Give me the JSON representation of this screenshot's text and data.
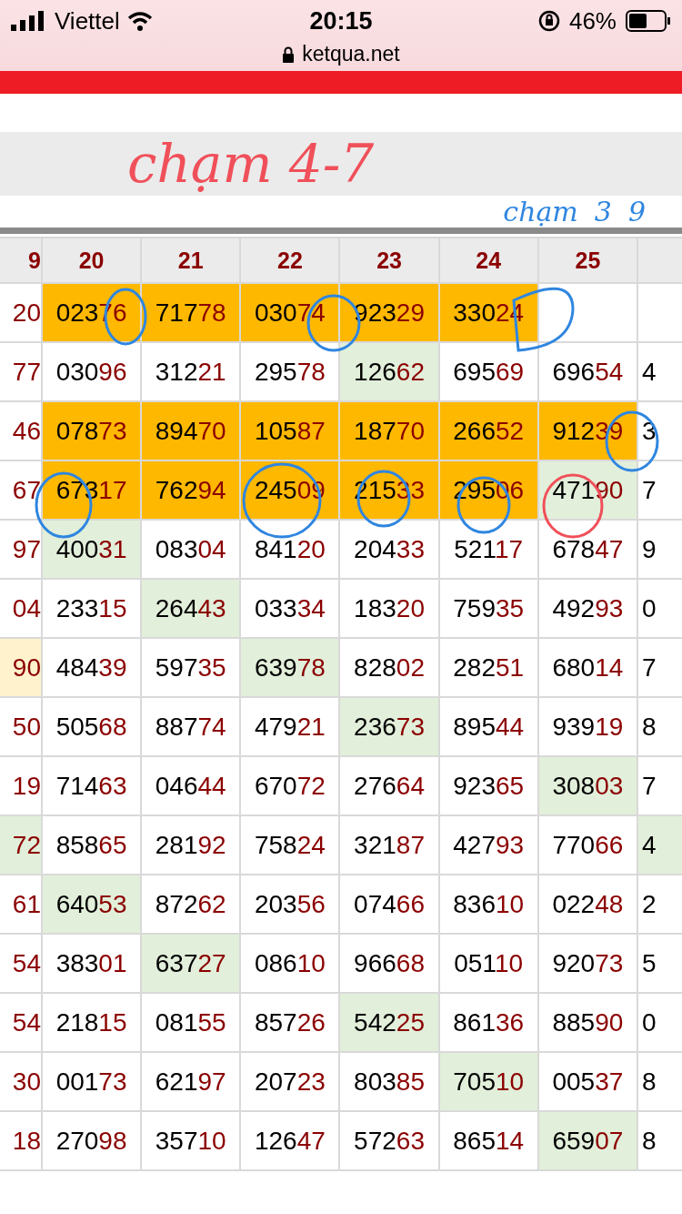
{
  "status_bar": {
    "carrier": "Viettel",
    "time": "20:15",
    "battery": "46%",
    "url": "ketqua.net"
  },
  "annotation": {
    "text": "chạm 4-7",
    "color": "#f0505a"
  },
  "notes": [
    {
      "text": "chạm",
      "color": "#2f86e0"
    },
    {
      "text": "3",
      "color": "#2f86e0"
    },
    {
      "text": "9",
      "color": "#2f86e0"
    }
  ],
  "table": {
    "columns": [
      "9",
      "20",
      "21",
      "22",
      "23",
      "24",
      "25",
      ""
    ],
    "rows": [
      [
        {
          "tail": "20"
        },
        {
          "head": "023",
          "tail": "76",
          "color": "#ffb800"
        },
        {
          "head": "717",
          "tail": "78",
          "color": "#ffb800"
        },
        {
          "head": "030",
          "tail": "74",
          "color": "#ffb800"
        },
        {
          "head": "923",
          "tail": "29",
          "color": "#ffb800"
        },
        {
          "head": "330",
          "tail": "24",
          "color": "#ffb800"
        },
        {},
        {}
      ],
      [
        {
          "tail": "77"
        },
        {
          "head": "030",
          "tail": "96"
        },
        {
          "head": "312",
          "tail": "21"
        },
        {
          "head": "295",
          "tail": "78"
        },
        {
          "head": "126",
          "tail": "62",
          "color": "#e2efda"
        },
        {
          "head": "695",
          "tail": "69"
        },
        {
          "head": "696",
          "tail": "54"
        },
        {
          "head": "4"
        }
      ],
      [
        {
          "tail": "46"
        },
        {
          "head": "078",
          "tail": "73",
          "color": "#ffb800"
        },
        {
          "head": "894",
          "tail": "70",
          "color": "#ffb800"
        },
        {
          "head": "105",
          "tail": "87",
          "color": "#ffb800"
        },
        {
          "head": "187",
          "tail": "70",
          "color": "#ffb800"
        },
        {
          "head": "266",
          "tail": "52",
          "color": "#ffb800"
        },
        {
          "head": "912",
          "tail": "39",
          "color": "#ffb800"
        },
        {
          "head": "3"
        }
      ],
      [
        {
          "tail": "67"
        },
        {
          "head": "673",
          "tail": "17",
          "color": "#ffb800"
        },
        {
          "head": "762",
          "tail": "94",
          "color": "#ffb800"
        },
        {
          "head": "245",
          "tail": "09",
          "color": "#ffb800"
        },
        {
          "head": "215",
          "tail": "33",
          "color": "#ffb800"
        },
        {
          "head": "295",
          "tail": "06",
          "color": "#ffb800"
        },
        {
          "head": "471",
          "tail": "90",
          "color": "#e2efda"
        },
        {
          "head": "7"
        }
      ],
      [
        {
          "tail": "97"
        },
        {
          "head": "400",
          "tail": "31",
          "color": "#e2efda"
        },
        {
          "head": "083",
          "tail": "04"
        },
        {
          "head": "841",
          "tail": "20"
        },
        {
          "head": "204",
          "tail": "33"
        },
        {
          "head": "521",
          "tail": "17"
        },
        {
          "head": "678",
          "tail": "47"
        },
        {
          "head": "9"
        }
      ],
      [
        {
          "tail": "04"
        },
        {
          "head": "233",
          "tail": "15"
        },
        {
          "head": "264",
          "tail": "43",
          "color": "#e2efda"
        },
        {
          "head": "033",
          "tail": "34"
        },
        {
          "head": "183",
          "tail": "20"
        },
        {
          "head": "759",
          "tail": "35"
        },
        {
          "head": "492",
          "tail": "93"
        },
        {
          "head": "0"
        }
      ],
      [
        {
          "tail": "90",
          "color": "#fff2cc"
        },
        {
          "head": "484",
          "tail": "39"
        },
        {
          "head": "597",
          "tail": "35"
        },
        {
          "head": "639",
          "tail": "78",
          "color": "#e2efda"
        },
        {
          "head": "828",
          "tail": "02"
        },
        {
          "head": "282",
          "tail": "51"
        },
        {
          "head": "680",
          "tail": "14"
        },
        {
          "head": "7"
        }
      ],
      [
        {
          "tail": "50"
        },
        {
          "head": "505",
          "tail": "68"
        },
        {
          "head": "887",
          "tail": "74"
        },
        {
          "head": "479",
          "tail": "21"
        },
        {
          "head": "236",
          "tail": "73",
          "color": "#e2efda"
        },
        {
          "head": "895",
          "tail": "44"
        },
        {
          "head": "939",
          "tail": "19"
        },
        {
          "head": "8"
        }
      ],
      [
        {
          "tail": "19"
        },
        {
          "head": "714",
          "tail": "63"
        },
        {
          "head": "046",
          "tail": "44"
        },
        {
          "head": "670",
          "tail": "72"
        },
        {
          "head": "276",
          "tail": "64"
        },
        {
          "head": "923",
          "tail": "65"
        },
        {
          "head": "308",
          "tail": "03",
          "color": "#e2efda"
        },
        {
          "head": "7"
        }
      ],
      [
        {
          "tail": "72",
          "color": "#e2efda"
        },
        {
          "head": "858",
          "tail": "65"
        },
        {
          "head": "281",
          "tail": "92"
        },
        {
          "head": "758",
          "tail": "24"
        },
        {
          "head": "321",
          "tail": "87"
        },
        {
          "head": "427",
          "tail": "93"
        },
        {
          "head": "770",
          "tail": "66"
        },
        {
          "head": "4",
          "color": "#e2efda"
        }
      ],
      [
        {
          "tail": "61"
        },
        {
          "head": "640",
          "tail": "53",
          "color": "#e2efda"
        },
        {
          "head": "872",
          "tail": "62"
        },
        {
          "head": "203",
          "tail": "56"
        },
        {
          "head": "074",
          "tail": "66"
        },
        {
          "head": "836",
          "tail": "10"
        },
        {
          "head": "022",
          "tail": "48"
        },
        {
          "head": "2"
        }
      ],
      [
        {
          "tail": "54"
        },
        {
          "head": "383",
          "tail": "01"
        },
        {
          "head": "637",
          "tail": "27",
          "color": "#e2efda"
        },
        {
          "head": "086",
          "tail": "10"
        },
        {
          "head": "966",
          "tail": "68"
        },
        {
          "head": "051",
          "tail": "10"
        },
        {
          "head": "920",
          "tail": "73"
        },
        {
          "head": "5"
        }
      ],
      [
        {
          "tail": "54"
        },
        {
          "head": "218",
          "tail": "15"
        },
        {
          "head": "081",
          "tail": "55"
        },
        {
          "head": "857",
          "tail": "26"
        },
        {
          "head": "542",
          "tail": "25",
          "color": "#e2efda"
        },
        {
          "head": "861",
          "tail": "36"
        },
        {
          "head": "885",
          "tail": "90"
        },
        {
          "head": "0"
        }
      ],
      [
        {
          "tail": "30"
        },
        {
          "head": "001",
          "tail": "73"
        },
        {
          "head": "621",
          "tail": "97"
        },
        {
          "head": "207",
          "tail": "23"
        },
        {
          "head": "803",
          "tail": "85"
        },
        {
          "head": "705",
          "tail": "10",
          "color": "#e2efda"
        },
        {
          "head": "005",
          "tail": "37"
        },
        {
          "head": "8"
        }
      ],
      [
        {
          "tail": "18"
        },
        {
          "head": "270",
          "tail": "98"
        },
        {
          "head": "357",
          "tail": "10"
        },
        {
          "head": "126",
          "tail": "47"
        },
        {
          "head": "572",
          "tail": "63"
        },
        {
          "head": "865",
          "tail": "14"
        },
        {
          "head": "659",
          "tail": "07",
          "color": "#e2efda"
        },
        {
          "head": "8"
        }
      ]
    ]
  }
}
